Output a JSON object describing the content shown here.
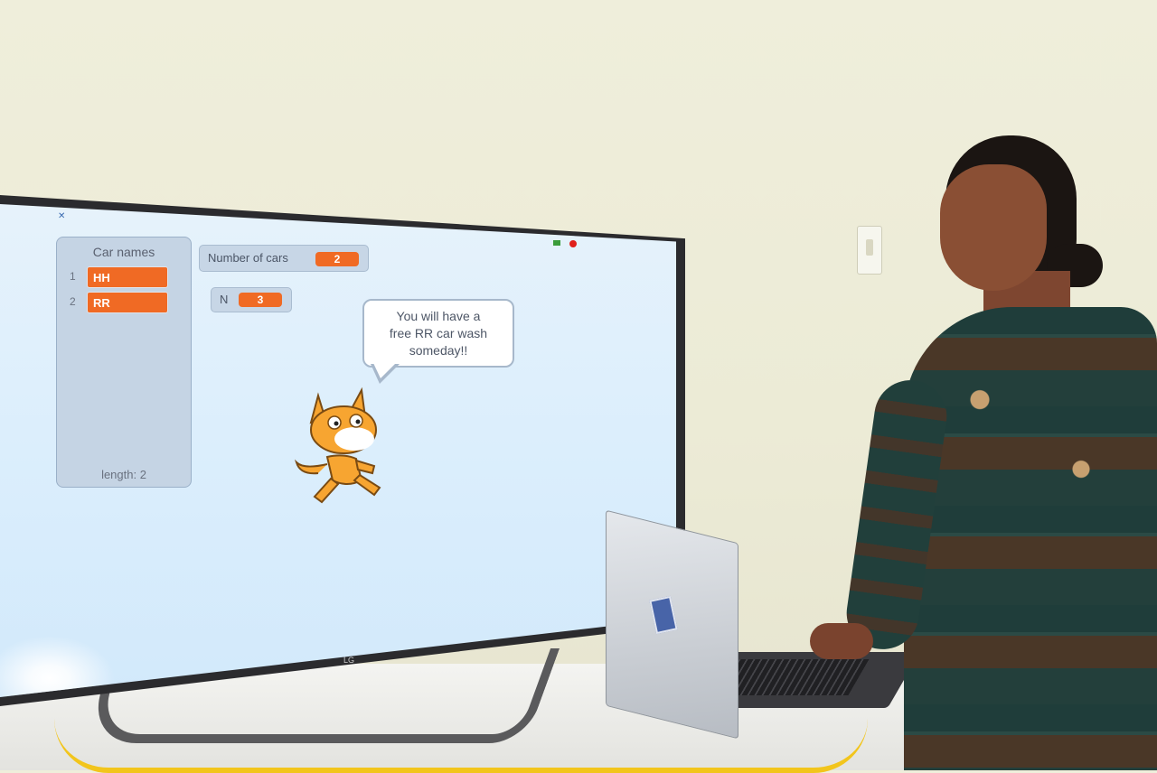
{
  "scratch": {
    "list_monitor": {
      "title": "Car names",
      "items": [
        {
          "index": "1",
          "value": "HH"
        },
        {
          "index": "2",
          "value": "RR"
        }
      ],
      "length_label": "length: 2"
    },
    "var_cars": {
      "label": "Number of cars",
      "value": "2"
    },
    "var_n": {
      "label": "N",
      "value": "3"
    },
    "speech_bubble": {
      "line1": "You will have a",
      "line2": "free RR  car wash",
      "line3": "someday!!"
    }
  },
  "tv": {
    "brand": "LG"
  },
  "colors": {
    "list_item": "#f06a24",
    "monitor_bg": "#c5d4e4",
    "stage_bg": "#dbeefc"
  }
}
